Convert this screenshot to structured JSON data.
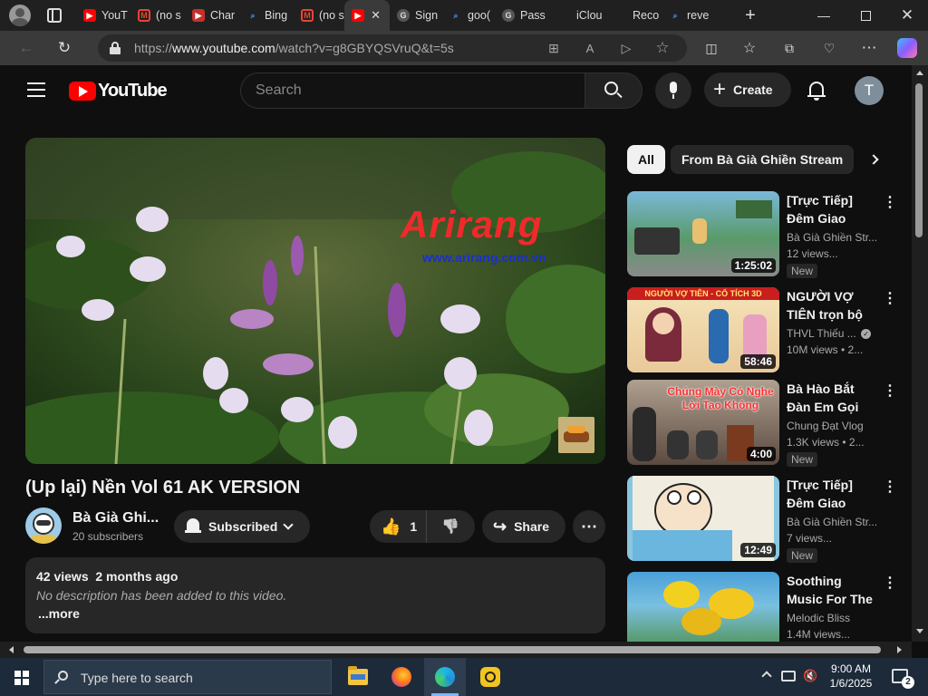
{
  "browser": {
    "tabs": [
      {
        "label": "YouT",
        "fav": "youtube"
      },
      {
        "label": "(no s",
        "fav": "gmail"
      },
      {
        "label": "Char",
        "fav": "youtube-studio"
      },
      {
        "label": "Bing",
        "fav": "bing"
      },
      {
        "label": "(no s",
        "fav": "gmail"
      },
      {
        "label": "",
        "fav": "youtube"
      },
      {
        "label": "Sign",
        "fav": "google"
      },
      {
        "label": "goo(",
        "fav": "search"
      },
      {
        "label": "Pass",
        "fav": "google"
      },
      {
        "label": "iClou",
        "fav": "apple"
      },
      {
        "label": "Reco",
        "fav": "apple"
      },
      {
        "label": "reve",
        "fav": "search"
      }
    ],
    "url_prefix": "https://",
    "url_host": "www.youtube.com",
    "url_path": "/watch?v=g8GBYQSVruQ&t=5s"
  },
  "youtube": {
    "logo_text": "YouTube",
    "search_placeholder": "Search",
    "create_label": "Create",
    "avatar_letter": "T",
    "video": {
      "title": "(Up lại) Nền Vol 61 AK VERSION",
      "channel": "Bà Già Ghi...",
      "subscribers": "20 subscribers",
      "subscribe_label": "Subscribed",
      "likes": "1",
      "share_label": "Share",
      "watermark_brand": "Arirang",
      "watermark_url": "www.arirang.com.vn",
      "description": {
        "stats": "42 views  2 months ago",
        "text": "No description has been added to this video.",
        "more": "...more"
      }
    },
    "chips": [
      "All",
      "From Bà Già Ghiền Stream"
    ],
    "recommendations": [
      {
        "title": "[Trực Tiếp] Đêm Giao Thừa...",
        "channel": "Bà Già Ghiền Str...",
        "views": "12 views...",
        "badge": "New",
        "duration": "1:25:02",
        "verified": false
      },
      {
        "title": "NGƯỜI VỢ TIÊN trọn bộ🌹🌷 C...",
        "channel": "THVL Thiếu ...",
        "views": "10M views  • 2...",
        "badge": "",
        "duration": "58:46",
        "verified": true,
        "thumb_text": "NGƯỜI VỢ TIÊN - CỔ TÍCH 3D"
      },
      {
        "title": "Bà Hào Bắt Đàn Em Gọi Chung...",
        "channel": "Chung Đạt Vlog",
        "views": "1.3K views  • 2...",
        "badge": "New",
        "duration": "4:00",
        "verified": false,
        "thumb_text": "Chúng Mày Có Nghe Lời Tao Không"
      },
      {
        "title": "[Trực Tiếp] Đêm Giao Thừa...",
        "channel": "Bà Già Ghiền Str...",
        "views": "7 views...",
        "badge": "New",
        "duration": "12:49",
        "verified": false
      },
      {
        "title": "Soothing Music For The Nerve...",
        "channel": "Melodic Bliss",
        "views": "1.4M views...",
        "badge": "",
        "duration": "",
        "verified": false
      }
    ]
  },
  "taskbar": {
    "search_placeholder": "Type here to search",
    "time": "9:00 AM",
    "date": "1/6/2025",
    "notifications": "2"
  },
  "colors": {
    "bg": "#0f0f0f",
    "youtube_red": "#ff0000",
    "chip_active_bg": "#f1f1f1",
    "pill_bg": "#272727"
  }
}
